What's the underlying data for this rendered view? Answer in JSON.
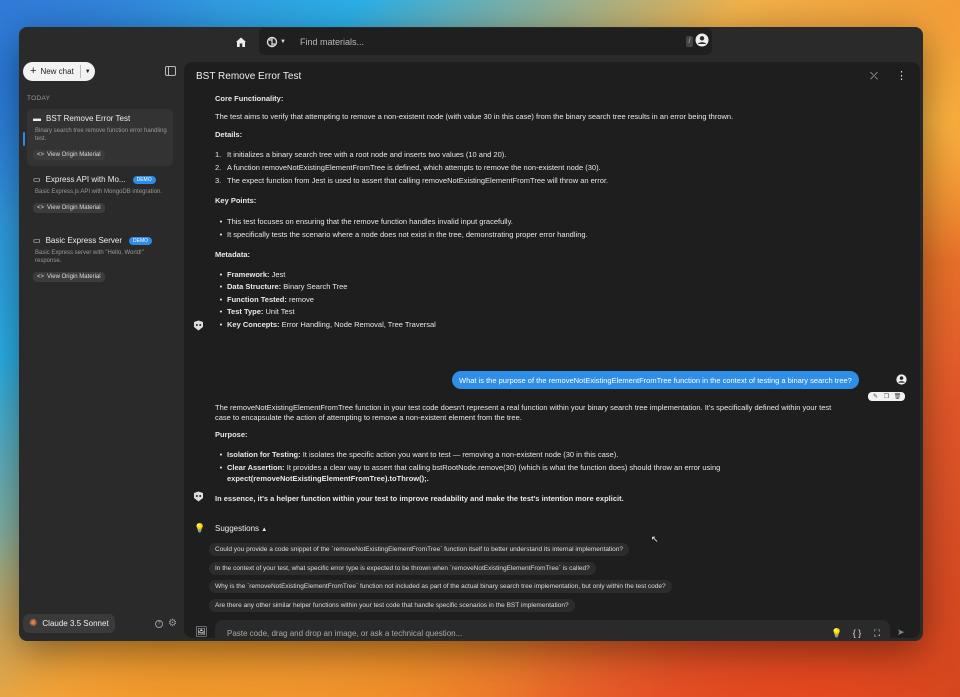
{
  "topbar": {
    "search_placeholder": "Find materials...",
    "slash_hint": "/"
  },
  "sidebar": {
    "new_chat_label": "New chat",
    "section_label": "TODAY",
    "origin_label": "View Origin Material",
    "chats": [
      {
        "title": "BST Remove Error Test",
        "description": "Binary search tree remove function error handling test.",
        "badge": "",
        "active": true
      },
      {
        "title": "Express API with Mo...",
        "description": "Basic Express.js API with MongoDB integration.",
        "badge": "DEMO",
        "active": false
      },
      {
        "title": "Basic Express Server",
        "description": "Basic Express server with \"Hello, World!\" response.",
        "badge": "DEMO",
        "active": false
      }
    ],
    "model_label": "Claude 3.5 Sonnet"
  },
  "main": {
    "title": "BST Remove Error Test",
    "assistant_1": {
      "core_heading": "Core Functionality:",
      "core_text": "The test aims to verify that attempting to remove a non-existent node (with value 30 in this case) from the binary search tree results in an error being thrown.",
      "details_heading": "Details:",
      "details": [
        {
          "num": "1.",
          "text": "It initializes a binary search tree with a root node and inserts two values (10 and 20)."
        },
        {
          "num": "2.",
          "text": "A function removeNotExistingElementFromTree is defined, which attempts to remove the non-existent node (30)."
        },
        {
          "num": "3.",
          "text": "The expect function from Jest is used to assert that calling removeNotExistingElementFromTree will throw an error."
        }
      ],
      "keypoints_heading": "Key Points:",
      "keypoints": [
        "This test focuses on ensuring that the remove function handles invalid input gracefully.",
        "It specifically tests the scenario where a node does not exist in the tree, demonstrating proper error handling."
      ],
      "metadata_heading": "Metadata:",
      "metadata": [
        {
          "key": "Framework:",
          "value": "Jest"
        },
        {
          "key": "Data Structure:",
          "value": "Binary Search Tree"
        },
        {
          "key": "Function Tested:",
          "value": "remove"
        },
        {
          "key": "Test Type:",
          "value": "Unit Test"
        },
        {
          "key": "Key Concepts:",
          "value": "Error Handling, Node Removal, Tree Traversal"
        }
      ]
    },
    "user_message": "What is the purpose of the removeNotExistingElementFromTree function in the context of testing a binary search tree?",
    "assistant_2": {
      "intro_line1": "The removeNotExistingElementFromTree function in your test code doesn't represent a real function within your binary search tree implementation. It's specifically defined within your test",
      "intro_line2": "case to encapsulate the action of attempting to remove a non-existent element from the tree.",
      "purpose_heading": "Purpose:",
      "purpose": [
        {
          "key": "Isolation for Testing:",
          "value": "It isolates the specific action you want to test — removing a non-existent node (30 in this case)."
        },
        {
          "key": "Clear Assertion:",
          "value": "It provides a clear way to assert that calling bstRootNode.remove(30) (which is what the function does) should throw an error using"
        }
      ],
      "purpose_cont": "expect(removeNotExistingElementFromTree).toThrow();.",
      "summary": "In essence, it's a helper function within your test to improve readability and make the test's intention more explicit."
    },
    "suggestions_label": "Suggestions",
    "suggestions": [
      "Could you provide a code snippet of the `removeNotExistingElementFromTree` function itself to better understand its internal implementation?",
      "In the context of your test, what specific error type is expected to be thrown when `removeNotExistingElementFromTree` is called?",
      "Why is the `removeNotExistingElementFromTree` function not included as part of the actual binary search tree implementation, but only within the test code?",
      "Are there any other similar helper functions within your test code that handle specific scenarios in the BST implementation?"
    ],
    "composer_placeholder": "Paste code, drag and drop an image, or ask a technical question..."
  }
}
